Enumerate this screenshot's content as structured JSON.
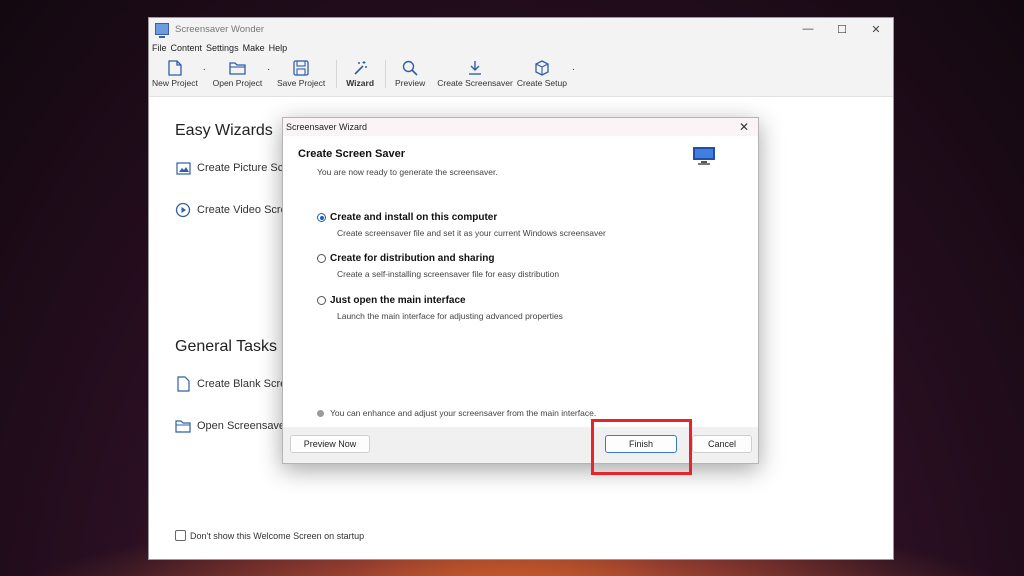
{
  "window": {
    "title": "Screensaver Wonder",
    "controls": [
      "—",
      "☐",
      "✕"
    ]
  },
  "menu": [
    "File",
    "Content",
    "Settings",
    "Make",
    "Help"
  ],
  "toolbar": {
    "new_project": "New Project",
    "open_project": "Open Project",
    "save_project": "Save Project",
    "wizard": "Wizard",
    "preview": "Preview",
    "create_screensaver": "Create Screensaver",
    "create_setup": "Create Setup",
    "dot": "."
  },
  "welcome": {
    "easy_wizards_title": "Easy Wizards",
    "create_picture": "Create Picture Scr",
    "create_video": "Create Video Scre",
    "general_tasks_title": "General Tasks",
    "create_blank": "Create Blank Scre",
    "open_screensaver": "Open Screensaver",
    "startup_checkbox": "Don't show this Welcome Screen on startup"
  },
  "dialog": {
    "title": "Screensaver Wizard",
    "close": "✕",
    "heading": "Create Screen Saver",
    "subtitle": "You are now ready to generate the screensaver.",
    "options": [
      {
        "label": "Create and install on this computer",
        "desc": "Create screensaver file and set it as your current Windows screensaver",
        "selected": true
      },
      {
        "label": "Create for distribution and sharing",
        "desc": "Create a self-installing screensaver file for easy distribution",
        "selected": false
      },
      {
        "label": "Just open the main interface",
        "desc": "Launch the main interface for adjusting advanced properties",
        "selected": false
      }
    ],
    "note": "You can enhance and adjust your screensaver from the main interface.",
    "preview_button": "Preview Now",
    "finish_button": "Finish",
    "cancel_button": "Cancel"
  },
  "colors": {
    "accent": "#1f5fbf",
    "highlight": "#e5252a"
  }
}
